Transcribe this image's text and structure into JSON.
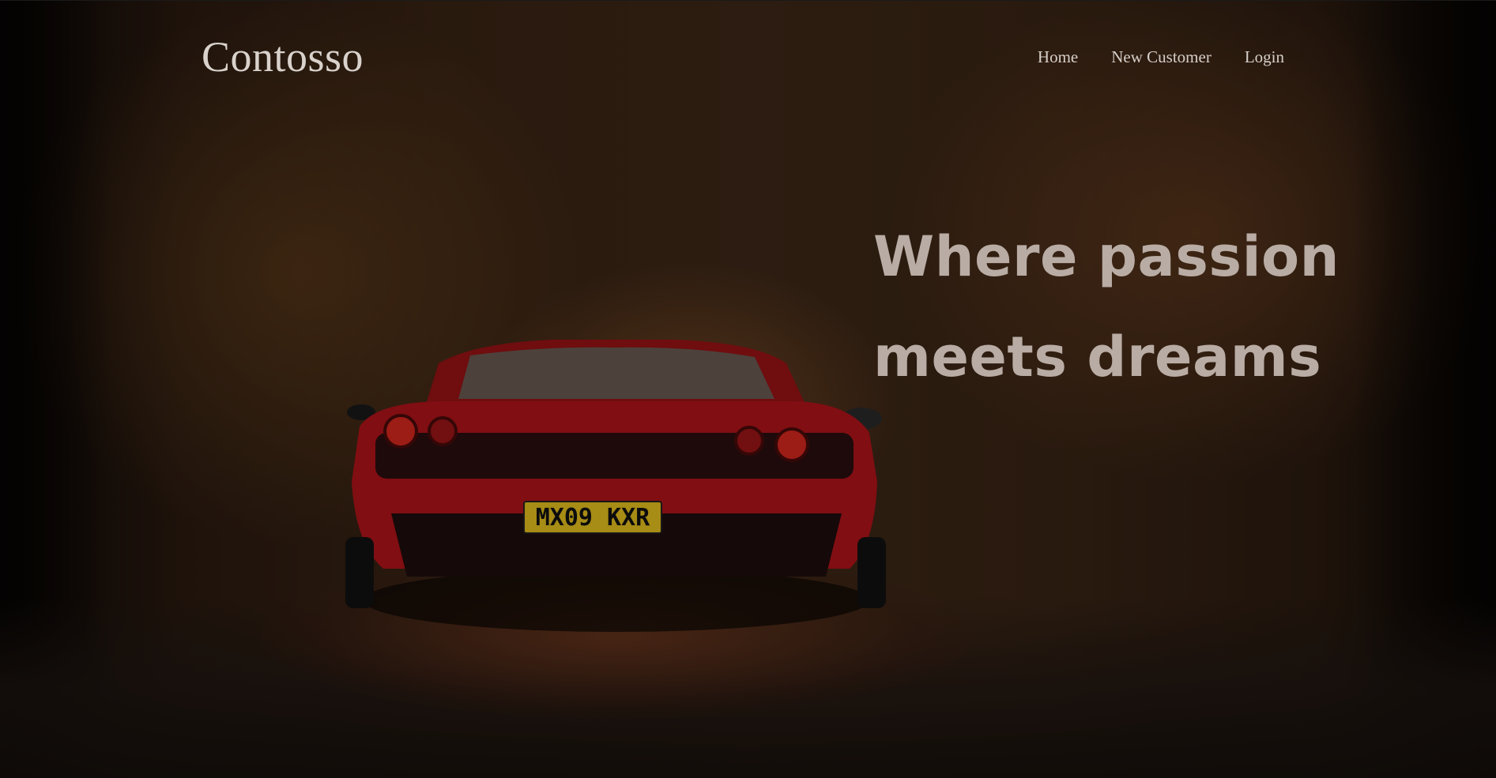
{
  "header": {
    "brand": "Contosso",
    "nav": [
      {
        "label": "Home"
      },
      {
        "label": "New Customer"
      },
      {
        "label": "Login"
      }
    ]
  },
  "hero": {
    "headline_line1": "Where passion",
    "headline_line2": "meets dreams",
    "image": {
      "plate_text": "MX09 KXR"
    }
  },
  "colors": {
    "text_light": "#d9d2cc",
    "headline": "#b8aca4",
    "car_red": "#b3141a",
    "plate_yellow": "#e8c21e"
  }
}
